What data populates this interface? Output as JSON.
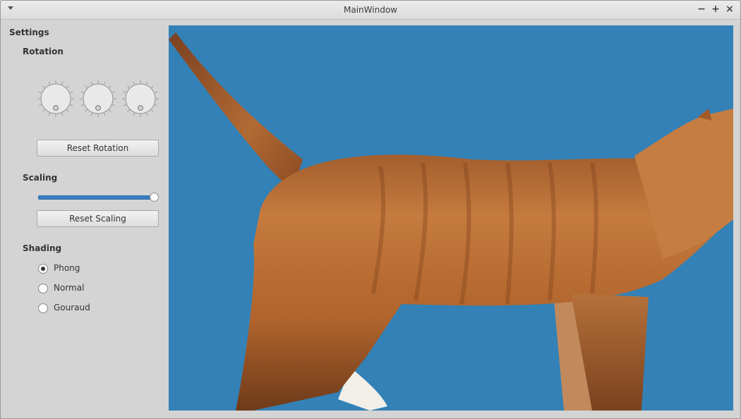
{
  "window": {
    "title": "MainWindow"
  },
  "settings": {
    "title": "Settings",
    "rotation": {
      "label": "Rotation",
      "reset_label": "Reset Rotation"
    },
    "scaling": {
      "label": "Scaling",
      "reset_label": "Reset Scaling",
      "value": 1.0
    },
    "shading": {
      "label": "Shading",
      "options": [
        {
          "label": "Phong",
          "selected": true
        },
        {
          "label": "Normal",
          "selected": false
        },
        {
          "label": "Gouraud",
          "selected": false
        }
      ]
    }
  },
  "viewport": {
    "background": "#3381b6",
    "subject": "3D textured cat model"
  }
}
